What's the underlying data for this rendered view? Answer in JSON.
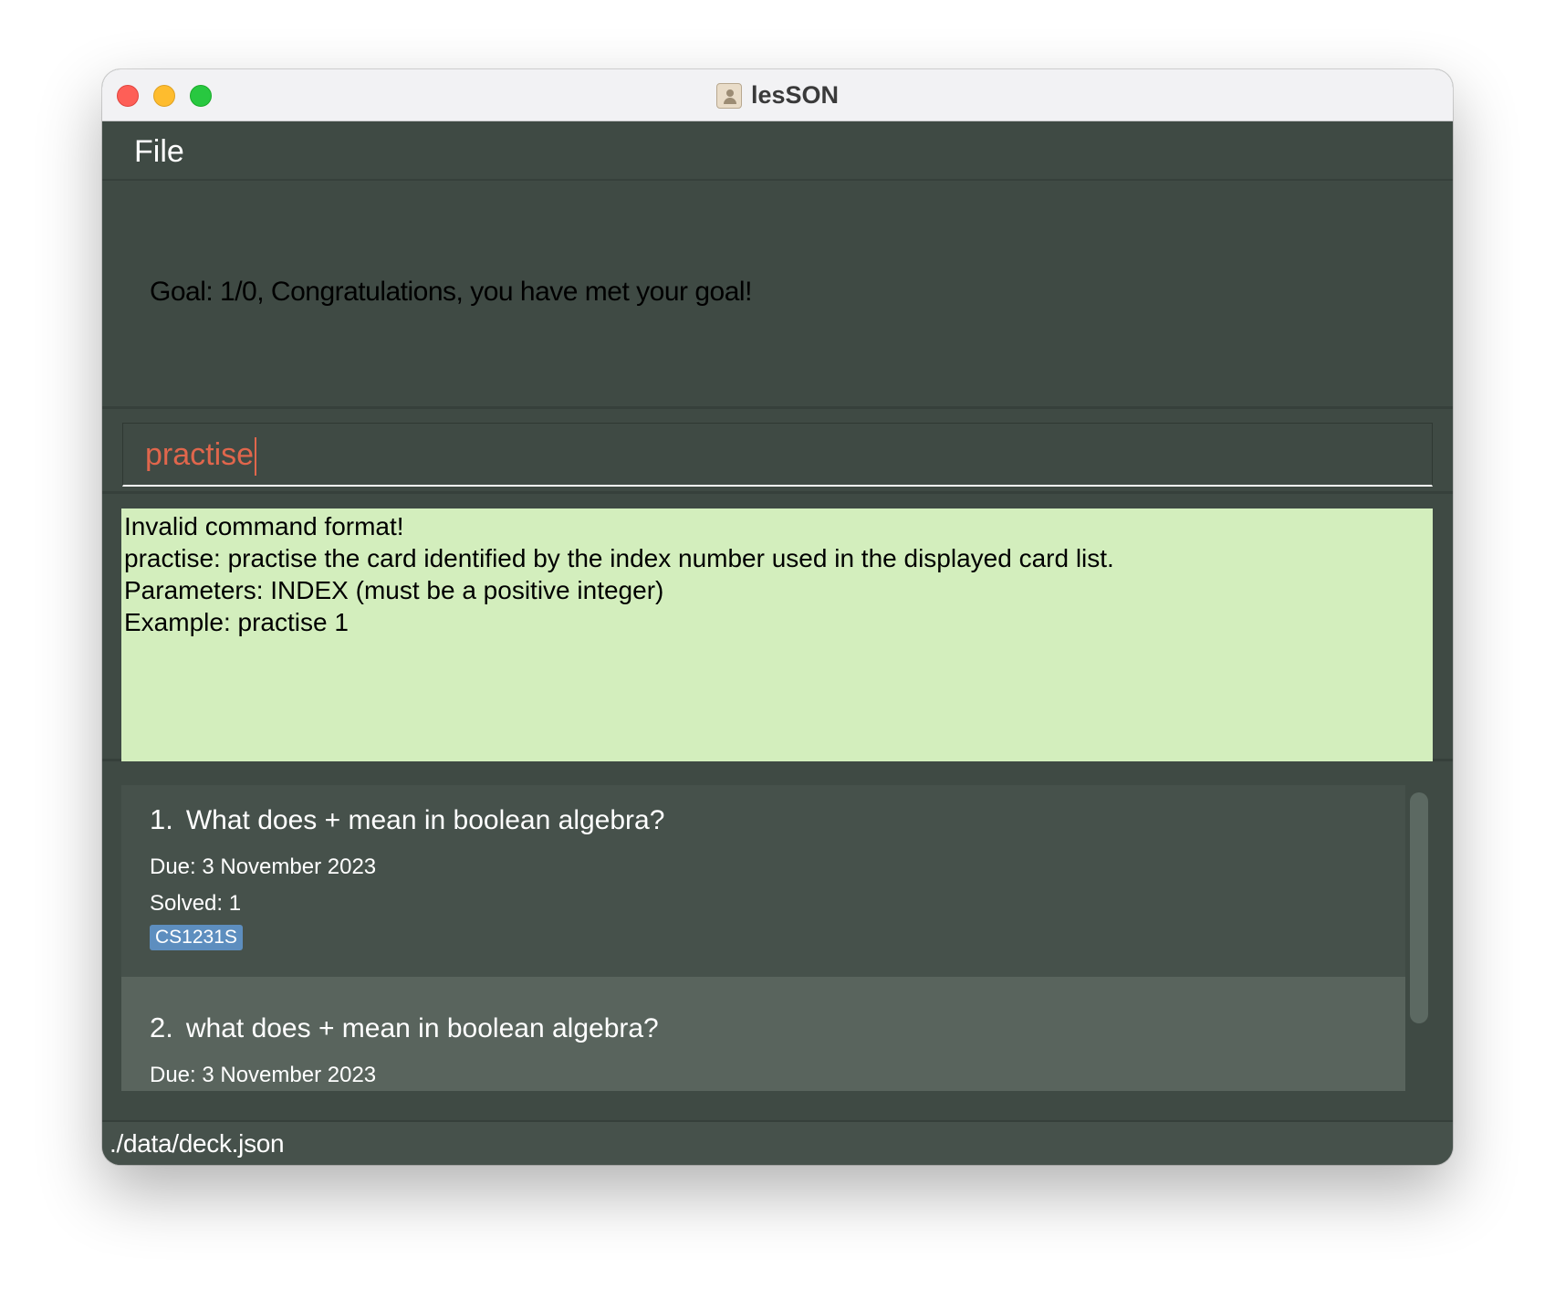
{
  "window": {
    "title": "lesSON",
    "app_icon": "contacts-icon"
  },
  "menu": {
    "file_label": "File"
  },
  "goal": {
    "text": "Goal: 1/0, Congratulations, you have met your goal!"
  },
  "command": {
    "value": "practise"
  },
  "result": {
    "lines": [
      "Invalid command format!",
      "practise: practise the card identified by the index number used in the displayed card list.",
      "Parameters: INDEX (must be a positive integer)",
      "Example: practise 1"
    ]
  },
  "cards": [
    {
      "index": "1.",
      "question": "What does + mean in boolean algebra?",
      "due": "Due: 3 November 2023",
      "solved": "Solved: 1",
      "tag": "CS1231S"
    },
    {
      "index": "2.",
      "question": "what does + mean in boolean algebra?",
      "due": "Due: 3 November 2023"
    }
  ],
  "status": {
    "path": "./data/deck.json"
  },
  "colors": {
    "background": "#3f4a44",
    "result_background": "#d3eebd",
    "command_text": "#e0664c",
    "tag": "#5d8ebf"
  }
}
